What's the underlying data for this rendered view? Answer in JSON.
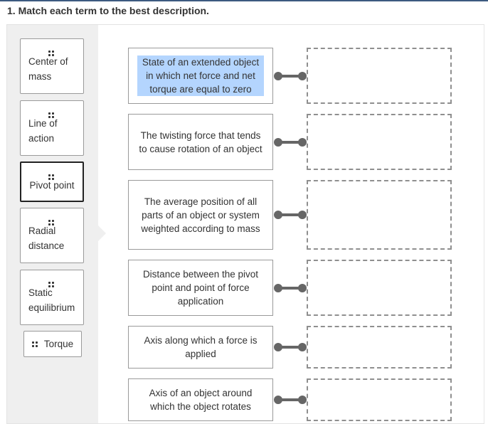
{
  "question": {
    "number": "1.",
    "title": "1. Match each term to the best description."
  },
  "colors": {
    "top_bar": "#3c5a80",
    "bank_background": "#efefef",
    "selection_highlight": "#b4d5fe",
    "connector": "#666666"
  },
  "terms": [
    {
      "label": "Center of mass",
      "icon": "drag-handle-icon",
      "selected": false
    },
    {
      "label": "Line of action",
      "icon": "drag-handle-icon",
      "selected": false
    },
    {
      "label": "Pivot point",
      "icon": "drag-handle-icon",
      "selected": true
    },
    {
      "label": "Radial distance",
      "icon": "drag-handle-icon",
      "selected": false
    },
    {
      "label": "Static equilibrium",
      "icon": "drag-handle-icon",
      "selected": false
    },
    {
      "label": "Torque",
      "icon": "drag-handle-icon",
      "selected": false
    }
  ],
  "descriptions": [
    {
      "text": "State of an extended object in which net force and net torque are equal to zero",
      "highlighted": true,
      "answer": ""
    },
    {
      "text": "The twisting force that tends to cause rotation of an object",
      "highlighted": false,
      "answer": ""
    },
    {
      "text": "The average position of all parts of an object or system weighted according to mass",
      "highlighted": false,
      "answer": ""
    },
    {
      "text": "Distance between the pivot point and point of force application",
      "highlighted": false,
      "answer": ""
    },
    {
      "text": "Axis along which a force is applied",
      "highlighted": false,
      "answer": ""
    },
    {
      "text": "Axis of an object around which the object rotates",
      "highlighted": false,
      "answer": ""
    }
  ]
}
